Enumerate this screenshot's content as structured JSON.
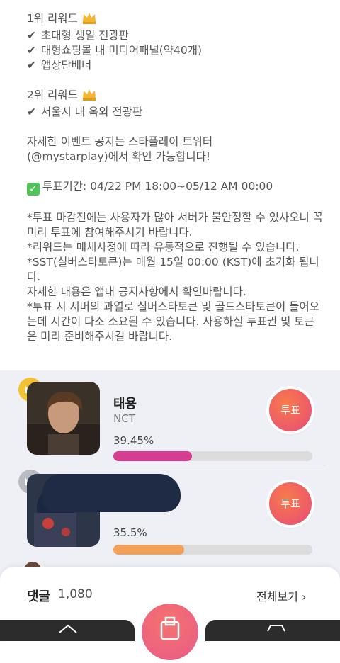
{
  "notice": {
    "rank1_title": "1위 리워드",
    "rank1_items": [
      "초대형 생일 전광판",
      "대형쇼핑몰 내 미디어패널(약40개)",
      "앱상단배너"
    ],
    "rank2_title": "2위 리워드",
    "rank2_items": [
      "서울시 내 옥외 전광판"
    ],
    "event_info_1": "자세한 이벤트 공지는 스타플레이 트위터",
    "event_info_2": "(@mystarplay)에서 확인 가능합니다!",
    "vote_period": "투표기간: 04/22 PM 18:00~05/12 AM 00:00",
    "note_1": "*투표 마감전에는 사용자가 많아 서버가 불안정할 수 있사오니 꼭 미리 투표에 참여해주시기 바랍니다.",
    "note_2": "*리워드는 매체사정에 따라 유동적으로 진행될 수 있습니다.",
    "note_3": "*SST(실버스타토큰)는 매월 15일 00:00 (KST)에 초기화 됩니다.",
    "note_4": "자세한 내용은 앱내 공지사항에서 확인바랍니다.",
    "note_5": "*투표 시 서버의 과열로 실버스타토큰 및 골드스타토큰이 들어오는데 시간이 다소 소요될 수 있습니다. 사용하실 투표권 및 토큰은 미리 준비해주시길 바랍니다."
  },
  "ranking": [
    {
      "name": "태용",
      "group": "NCT",
      "percent_text": "39.45%",
      "percent": 39.45,
      "bar_color": "#d63c8f",
      "badge_color": "#f2c230",
      "vote_label": "투표"
    },
    {
      "name": "",
      "group": "",
      "percent_text": "35.5%",
      "percent": 35.5,
      "bar_color": "#f2a05a",
      "badge_color": "#b9bbc2",
      "vote_label": "투표"
    }
  ],
  "comments": {
    "title": "댓글",
    "count": "1,080",
    "view_all": "전체보기 ›"
  },
  "colors": {
    "accent_gradient_start": "#f77b4a",
    "accent_gradient_end": "#e84a78",
    "rank_background": "#eef0f6"
  }
}
